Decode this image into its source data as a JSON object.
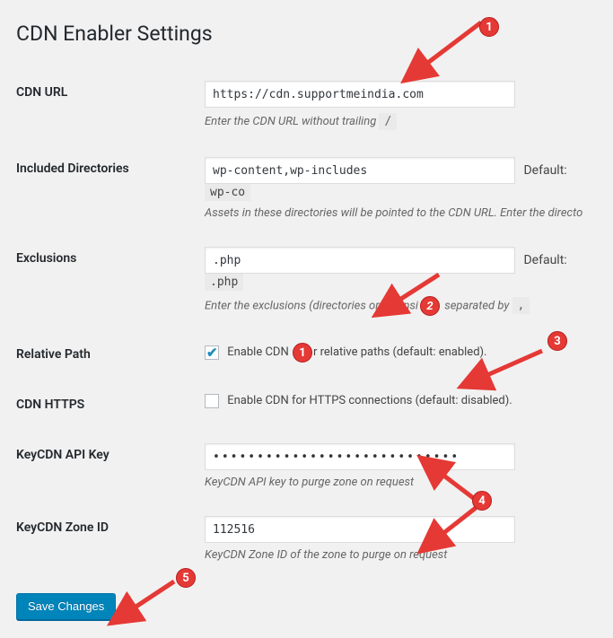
{
  "page": {
    "title": "CDN Enabler Settings"
  },
  "fields": {
    "cdn_url": {
      "label": "CDN URL",
      "value": "https://cdn.supportmeindia.com",
      "help_prefix": "Enter the CDN URL without trailing",
      "help_code": "/"
    },
    "included_dirs": {
      "label": "Included Directories",
      "value": "wp-content,wp-includes",
      "default_label": "Default:",
      "default_code": "wp-co",
      "help": "Assets in these directories will be pointed to the CDN URL. Enter the directo"
    },
    "exclusions": {
      "label": "Exclusions",
      "value": ".php",
      "default_label": "Default:",
      "default_code": ".php",
      "help_prefix": "Enter the exclusions (directories or extensi",
      "help_mid": " separated by",
      "help_code": ","
    },
    "relative_path": {
      "label": "Relative Path",
      "checked": true,
      "checkbox_prefix": "Enable CDN",
      "checkbox_suffix": "r relative paths (default: enabled)."
    },
    "cdn_https": {
      "label": "CDN HTTPS",
      "checked": false,
      "checkbox_label": "Enable CDN for HTTPS connections (default: disabled)."
    },
    "api_key": {
      "label": "KeyCDN API Key",
      "value": "••••••••••••••••••••••••••••",
      "help": "KeyCDN API key to purge zone on request"
    },
    "zone_id": {
      "label": "KeyCDN Zone ID",
      "value": "112516",
      "help": "KeyCDN Zone ID of the zone to purge on request"
    }
  },
  "submit": {
    "label": "Save Changes"
  },
  "callouts": {
    "c1": "1",
    "c1b": "1",
    "c2": "2",
    "c3": "3",
    "c4": "4",
    "c5": "5"
  }
}
